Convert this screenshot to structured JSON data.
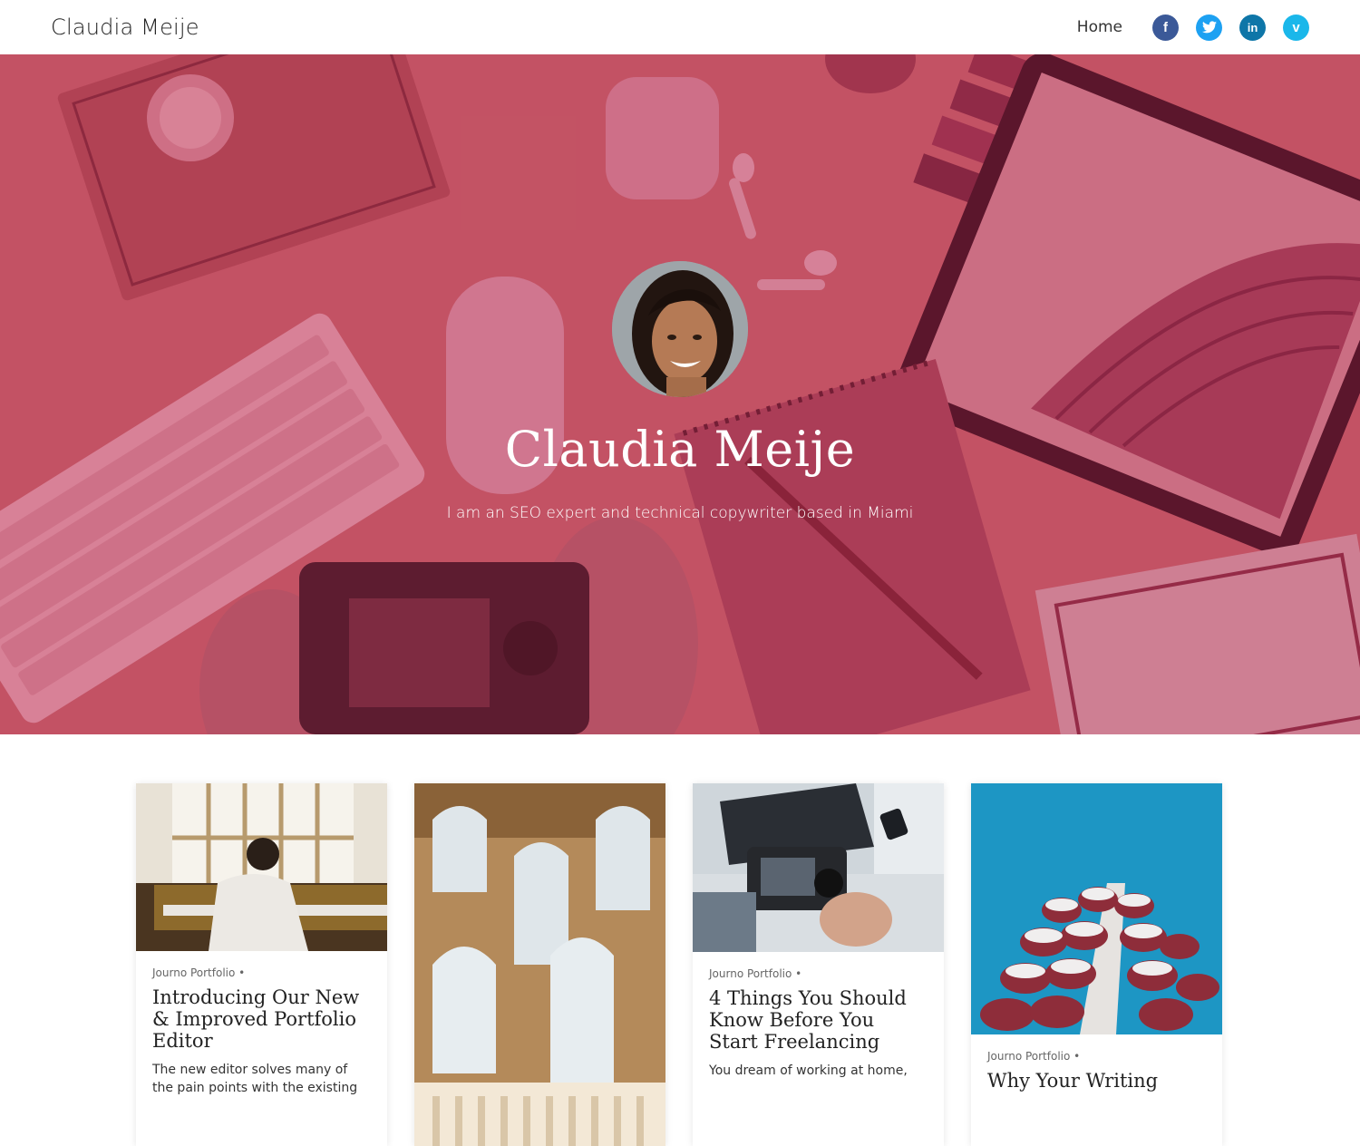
{
  "header": {
    "site_title": "Claudia Meije",
    "nav_home": "Home",
    "social": [
      {
        "icon": "facebook-icon",
        "glyph": "f",
        "color": "#3b5998"
      },
      {
        "icon": "twitter-icon",
        "glyph": "t",
        "color": "#1da1f2"
      },
      {
        "icon": "linkedin-icon",
        "glyph": "in",
        "color": "#0e76a8"
      },
      {
        "icon": "vimeo-icon",
        "glyph": "v",
        "color": "#1ab7ea"
      }
    ]
  },
  "hero": {
    "name": "Claudia Meije",
    "tagline": "I am an SEO expert and technical copywriter based in Miami",
    "overlay_color": "#c65e6a"
  },
  "cards": [
    {
      "meta": "Journo Portfolio •",
      "title": "Introducing Our New & Improved Portfolio Editor",
      "excerpt": "The new editor solves many of the pain points with the existing"
    },
    {
      "meta": "",
      "title": "",
      "excerpt": ""
    },
    {
      "meta": "Journo Portfolio •",
      "title": "4 Things You Should Know Before You Start Freelancing",
      "excerpt": "You dream of working at home, "
    },
    {
      "meta": "Journo Portfolio •",
      "title": "Why Your Writing",
      "excerpt": ""
    }
  ]
}
